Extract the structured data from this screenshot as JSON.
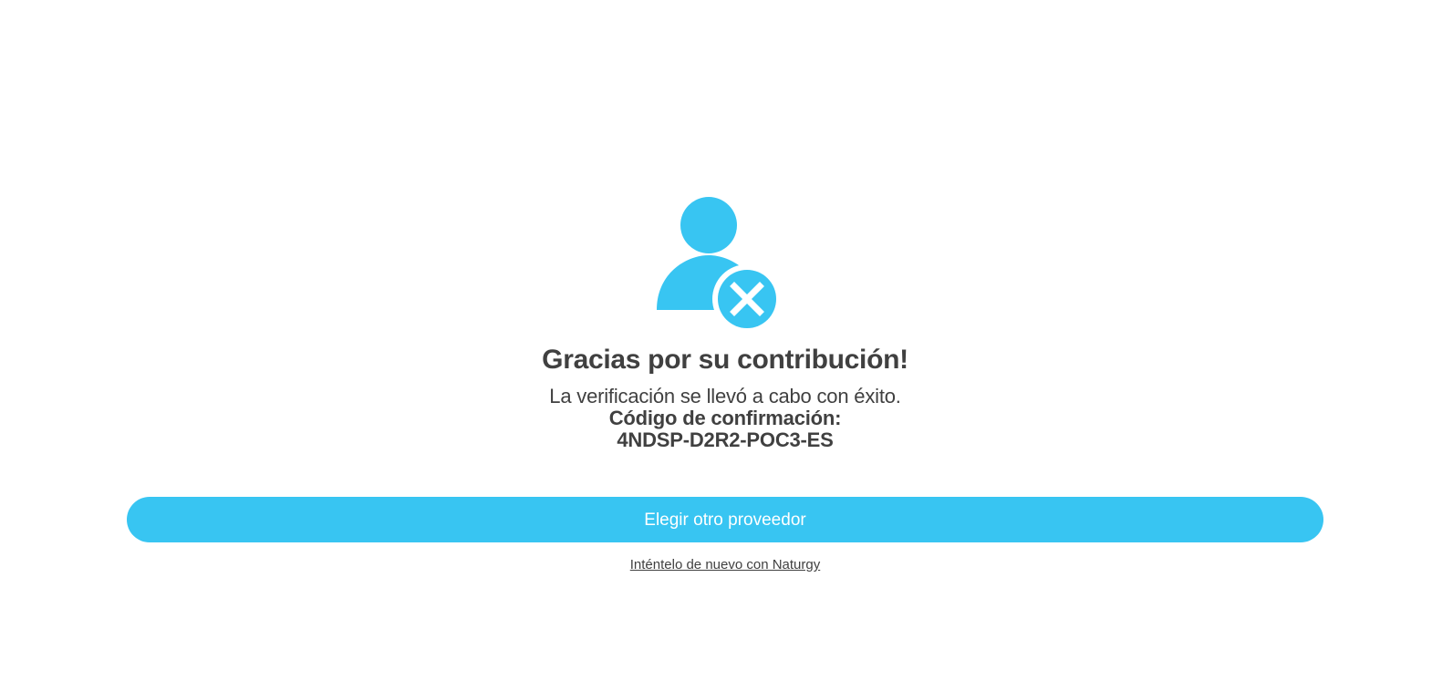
{
  "status_icon": {
    "name": "user-error-icon",
    "accent_color": "#38c5f2"
  },
  "heading": {
    "title": "Gracias por su contribución!",
    "message": "La verificación se llevó a cabo con éxito.",
    "code_label": "Código de confirmación:",
    "code_value": "4NDSP-D2R2-POC3-ES"
  },
  "actions": {
    "primary_label": "Elegir otro proveedor",
    "retry_link_label": "Inténtelo de nuevo con Naturgy"
  },
  "colors": {
    "accent": "#38c5f2",
    "text": "#404040",
    "background": "#ffffff"
  }
}
